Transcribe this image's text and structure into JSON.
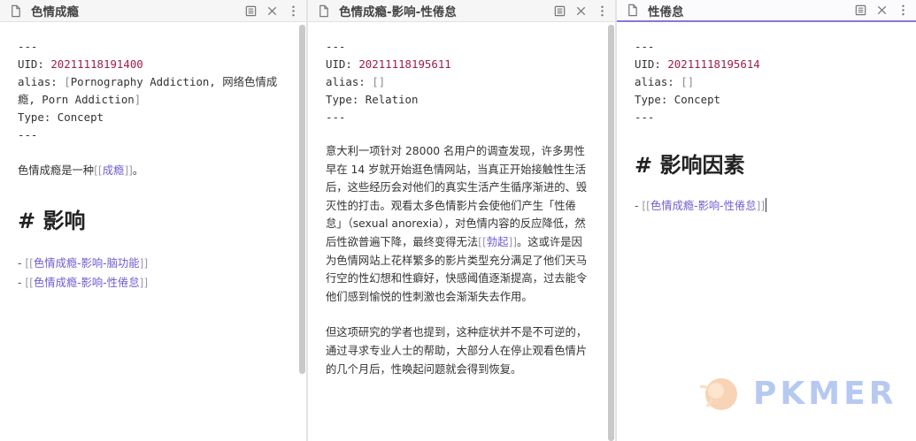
{
  "panes": [
    {
      "title": "色情成瘾",
      "yaml": {
        "dashes": "---",
        "uid_key": "UID:",
        "uid": "20211118191400",
        "alias_key": "alias:",
        "alias_open": "[",
        "alias_text": "Pornography Addiction, 网络色情成瘾, Porn Addiction",
        "alias_close": "]",
        "type_key": "Type:",
        "type": "Concept"
      },
      "intro_text": "色情成瘾是一种",
      "intro_link": "成瘾",
      "intro_end": "。",
      "heading": "# 影响",
      "list": [
        {
          "bullet": "- ",
          "link": "色情成瘾-影响-脑功能"
        },
        {
          "bullet": "- ",
          "link": "色情成瘾-影响-性倦怠"
        }
      ]
    },
    {
      "title": "色情成瘾-影响-性倦怠",
      "yaml": {
        "dashes": "---",
        "uid_key": "UID:",
        "uid": "20211118195611",
        "alias_key": "alias:",
        "alias": "[]",
        "type_key": "Type:",
        "type": "Relation"
      },
      "para1_a": "意大利一项针对 28000 名用户的调查发现，许多男性早在 14 岁就开始逛色情网站，当真正开始接触性生活后，这些经历会对他们的真实生活产生循序渐进的、毁灭性的打击。观看太多色情影片会使他们产生「性倦怠」（sexual anorexia），对色情内容的反应降低，然后性欲普遍下降，最终变得无法",
      "para1_link": "勃起",
      "para1_b": "。这或许是因为色情网站上花样繁多的影片类型充分满足了他们天马行空的性幻想和性癖好，快感阈值逐渐提高，过去能令他们感到愉悦的性刺激也会渐渐失去作用。",
      "para2": "但这项研究的学者也提到，这种症状并不是不可逆的，通过寻求专业人士的帮助，大部分人在停止观看色情片的几个月后，性唤起问题就会得到恢复。"
    },
    {
      "title": "性倦怠",
      "yaml": {
        "dashes": "---",
        "uid_key": "UID:",
        "uid": "20211118195614",
        "alias_key": "alias:",
        "alias": "[]",
        "type_key": "Type:",
        "type": "Concept"
      },
      "heading": "# 影响因素",
      "list": [
        {
          "bullet": "- ",
          "link": "色情成瘾-影响-性倦怠"
        }
      ]
    }
  ],
  "brand": {
    "name": "PKMER"
  },
  "colors": {
    "link": "#705dcf",
    "uid": "#9f1c4c",
    "active_tab": "#8b74de"
  }
}
